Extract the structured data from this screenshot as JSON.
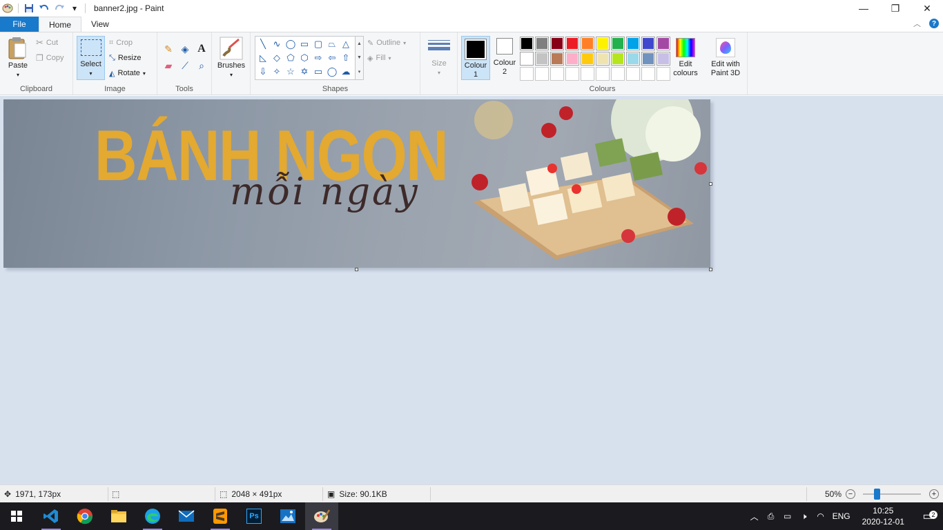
{
  "window": {
    "title": "banner2.jpg - Paint",
    "controls": {
      "minimize": "—",
      "restore": "❐",
      "close": "✕"
    }
  },
  "quick_access": {
    "dropdown": "▾"
  },
  "tabs": {
    "file": "File",
    "home": "Home",
    "view": "View"
  },
  "ribbon": {
    "clipboard": {
      "paste": "Paste",
      "cut": "Cut",
      "copy": "Copy",
      "label": "Clipboard"
    },
    "image": {
      "select": "Select",
      "crop": "Crop",
      "resize": "Resize",
      "rotate": "Rotate",
      "label": "Image"
    },
    "tools": {
      "label": "Tools"
    },
    "brushes": {
      "label": "Brushes"
    },
    "shapes": {
      "outline": "Outline",
      "fill": "Fill",
      "label": "Shapes"
    },
    "size": {
      "label": "Size"
    },
    "colours": {
      "colour1_line1": "Colour",
      "colour1_line2": "1",
      "colour2_line1": "Colour",
      "colour2_line2": "2",
      "edit_line1": "Edit",
      "edit_line2": "colours",
      "paint3d_line1": "Edit with",
      "paint3d_line2": "Paint 3D",
      "label": "Colours",
      "colour1_value": "#000000",
      "colour2_value": "#ffffff",
      "palette_row1": [
        "#000000",
        "#7f7f7f",
        "#880015",
        "#ed1c24",
        "#ff7f27",
        "#fff200",
        "#22b14c",
        "#00a2e8",
        "#3f48cc",
        "#a349a4"
      ],
      "palette_row2": [
        "#ffffff",
        "#c3c3c3",
        "#b97a57",
        "#ffaec9",
        "#ffc90e",
        "#efe4b0",
        "#b5e61d",
        "#99d9ea",
        "#7092be",
        "#c8bfe7"
      ],
      "palette_row3": [
        "#ffffff",
        "#ffffff",
        "#ffffff",
        "#ffffff",
        "#ffffff",
        "#ffffff",
        "#ffffff",
        "#ffffff",
        "#ffffff",
        "#ffffff"
      ]
    }
  },
  "canvas": {
    "title": "BÁNH NGON",
    "subtitle": "mỗi ngày"
  },
  "statusbar": {
    "cursor_position": "1971, 173px",
    "image_dimensions": "2048 × 491px",
    "file_size": "Size: 90.1KB",
    "zoom": "50%",
    "zoom_out": "−",
    "zoom_in": "+"
  },
  "taskbar": {
    "language": "ENG",
    "time": "10:25",
    "date": "2020-12-01",
    "notification_count": "2"
  }
}
